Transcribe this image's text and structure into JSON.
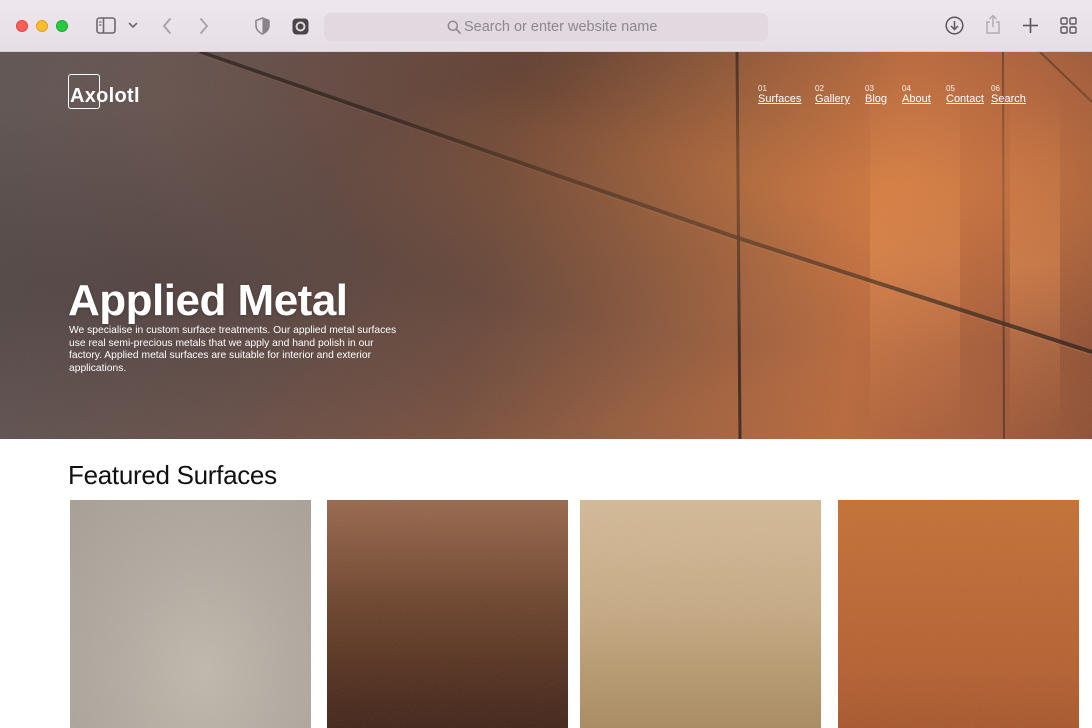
{
  "browser": {
    "url_placeholder": "Search or enter website name",
    "icons": [
      "sidebar-icon",
      "chevron-down-icon",
      "back-icon",
      "forward-icon",
      "privacy-shield-icon",
      "extension-icon",
      "search-icon",
      "download-icon",
      "share-icon",
      "new-tab-icon",
      "tab-overview-icon"
    ]
  },
  "site": {
    "logo": "Axolotl",
    "nav": [
      {
        "num": "01",
        "label": "Surfaces"
      },
      {
        "num": "02",
        "label": "Gallery"
      },
      {
        "num": "03",
        "label": "Blog"
      },
      {
        "num": "04",
        "label": "About"
      },
      {
        "num": "05",
        "label": "Contact"
      },
      {
        "num": "06",
        "label": "Search"
      }
    ],
    "hero": {
      "title": "Applied Metal",
      "description": "We specialise in custom surface treatments. Our applied metal surfaces use real semi-precious metals that we apply and hand polish in our factory. Applied metal surfaces are suitable for interior and exterior applications."
    },
    "featured": {
      "title": "Featured Surfaces"
    }
  },
  "colors": {
    "traffic_red": "#ff5f57",
    "traffic_yellow": "#febc2e",
    "traffic_green": "#28c840",
    "text_dark": "#111111"
  }
}
